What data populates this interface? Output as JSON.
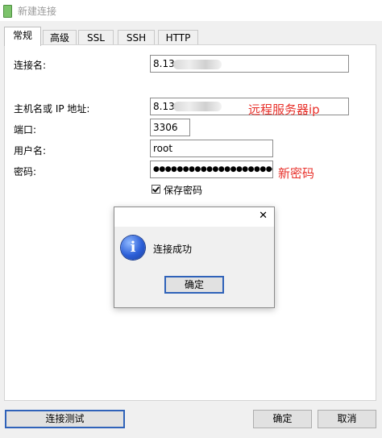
{
  "window": {
    "title": "新建连接"
  },
  "tabs": [
    {
      "label": "常规"
    },
    {
      "label": "高级"
    },
    {
      "label": "SSL"
    },
    {
      "label": "SSH"
    },
    {
      "label": "HTTP"
    }
  ],
  "form": {
    "connection_name_label": "连接名:",
    "connection_name_value": "8.13",
    "host_label": "主机名或 IP 地址:",
    "host_value": "8.13",
    "port_label": "端口:",
    "port_value": "3306",
    "user_label": "用户名:",
    "user_value": "root",
    "password_label": "密码:",
    "password_value": "●●●●●●●●●●●●●●●●●●●●●●",
    "save_password_label": "保存密码",
    "save_password_checked": true
  },
  "annotations": {
    "host_note": "远程服务器ip",
    "password_note": "新密码"
  },
  "dialog": {
    "message": "连接成功",
    "ok_label": "确定",
    "close_glyph": "✕",
    "icon_glyph": "i"
  },
  "footer": {
    "test_label": "连接测试",
    "ok_label": "确定",
    "cancel_label": "取消"
  },
  "colors": {
    "annotation": "#e8312b",
    "focus_border": "#2f62b9"
  }
}
